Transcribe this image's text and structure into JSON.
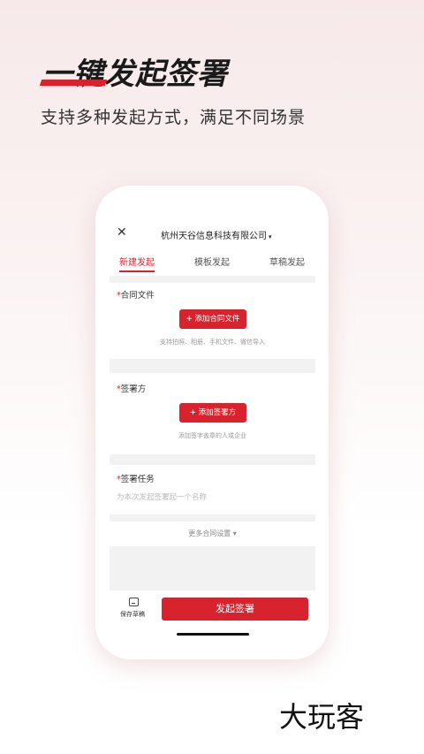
{
  "hero": {
    "title": "一键发起签署",
    "subtitle": "支持多种发起方式，满足不同场景"
  },
  "app": {
    "close_icon": "✕",
    "company": "杭州天谷信息科技有限公司",
    "company_caret": "▾",
    "tabs": [
      {
        "label": "新建发起",
        "active": true
      },
      {
        "label": "模板发起",
        "active": false
      },
      {
        "label": "草稿发起",
        "active": false
      }
    ],
    "contract": {
      "label": "合同文件",
      "required_mark": "*",
      "button": "+ 添加合同文件",
      "hint": "支持拍照、相册、手机文件、微信导入"
    },
    "signer": {
      "label": "签署方",
      "required_mark": "*",
      "button": "+ 添加签署方",
      "hint": "添加签字盖章的人或企业"
    },
    "task": {
      "label": "签署任务",
      "required_mark": "*",
      "placeholder": "为本次发起签署起一个名称"
    },
    "more_settings": "更多合同设置 ▾",
    "bottom": {
      "save_draft": "保存草稿",
      "submit": "发起签署"
    }
  },
  "watermark": "大玩客",
  "colors": {
    "accent": "#d8232f"
  }
}
